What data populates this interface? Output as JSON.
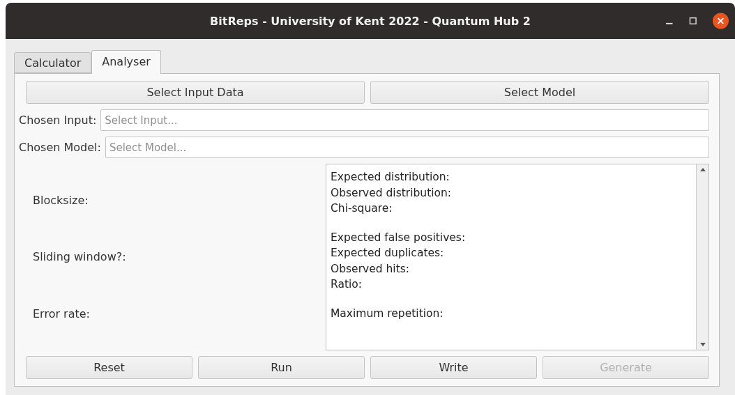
{
  "window": {
    "title": "BitReps - University of Kent 2022 - Quantum Hub 2"
  },
  "tabs": [
    {
      "label": "Calculator",
      "selected": false
    },
    {
      "label": "Analyser",
      "selected": true
    }
  ],
  "select_buttons": [
    {
      "label": "Select Input Data",
      "disabled": false
    },
    {
      "label": "Select Model",
      "disabled": false
    }
  ],
  "fields": [
    {
      "label": "Chosen Input:",
      "placeholder": "Select Input..."
    },
    {
      "label": "Chosen Model:",
      "placeholder": "Select Model..."
    }
  ],
  "parameters": [
    "Blocksize:",
    "Sliding window?:",
    "Error rate:"
  ],
  "output_groups": [
    [
      "Expected distribution:",
      "Observed distribution:",
      "Chi-square:"
    ],
    [
      "Expected false positives:",
      "Expected duplicates:",
      "Observed hits:",
      "Ratio:"
    ],
    [
      "Maximum repetition:"
    ]
  ],
  "action_buttons": [
    {
      "label": "Reset",
      "disabled": false
    },
    {
      "label": "Run",
      "disabled": false
    },
    {
      "label": "Write",
      "disabled": false
    },
    {
      "label": "Generate",
      "disabled": true
    }
  ]
}
